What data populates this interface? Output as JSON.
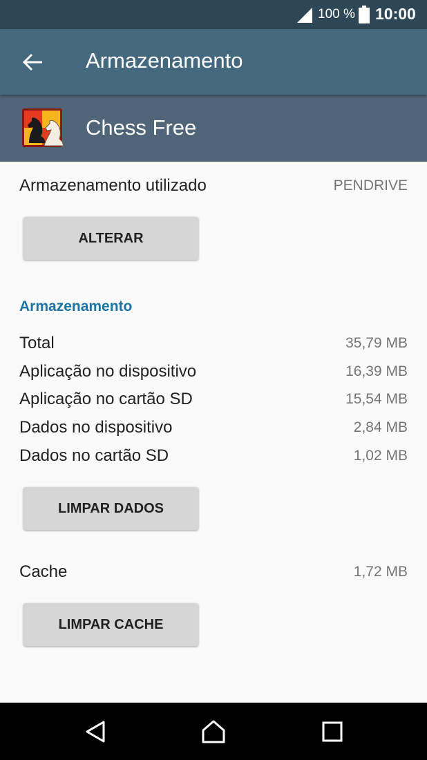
{
  "status_bar": {
    "battery_percent": "100 %",
    "time": "10:00",
    "icons": [
      "signal-icon",
      "battery-icon"
    ]
  },
  "toolbar": {
    "title": "Armazenamento",
    "back_icon": "back-arrow-icon"
  },
  "app_header": {
    "name": "Chess Free",
    "icon": "chess-app-icon"
  },
  "storage_used": {
    "label": "Armazenamento utilizado",
    "value": "PENDRIVE",
    "button": "ALTERAR"
  },
  "storage_section": {
    "title": "Armazenamento",
    "rows": [
      {
        "label": "Total",
        "value": "35,79 MB"
      },
      {
        "label": "Aplicação no dispositivo",
        "value": "16,39 MB"
      },
      {
        "label": "Aplicação no cartão SD",
        "value": "15,54 MB"
      },
      {
        "label": "Dados no dispositivo",
        "value": "2,84 MB"
      },
      {
        "label": "Dados no cartão SD",
        "value": "1,02 MB"
      }
    ],
    "clear_data_button": "LIMPAR DADOS"
  },
  "cache": {
    "label": "Cache",
    "value": "1,72 MB",
    "button": "LIMPAR CACHE"
  },
  "nav_bar": {
    "icons": [
      "back-triangle-icon",
      "home-icon",
      "recents-icon"
    ]
  },
  "colors": {
    "status_bar": "#2e4756",
    "toolbar": "#44697f",
    "app_header": "#506577",
    "accent": "#1a75a4",
    "button": "#d6d6d6"
  }
}
